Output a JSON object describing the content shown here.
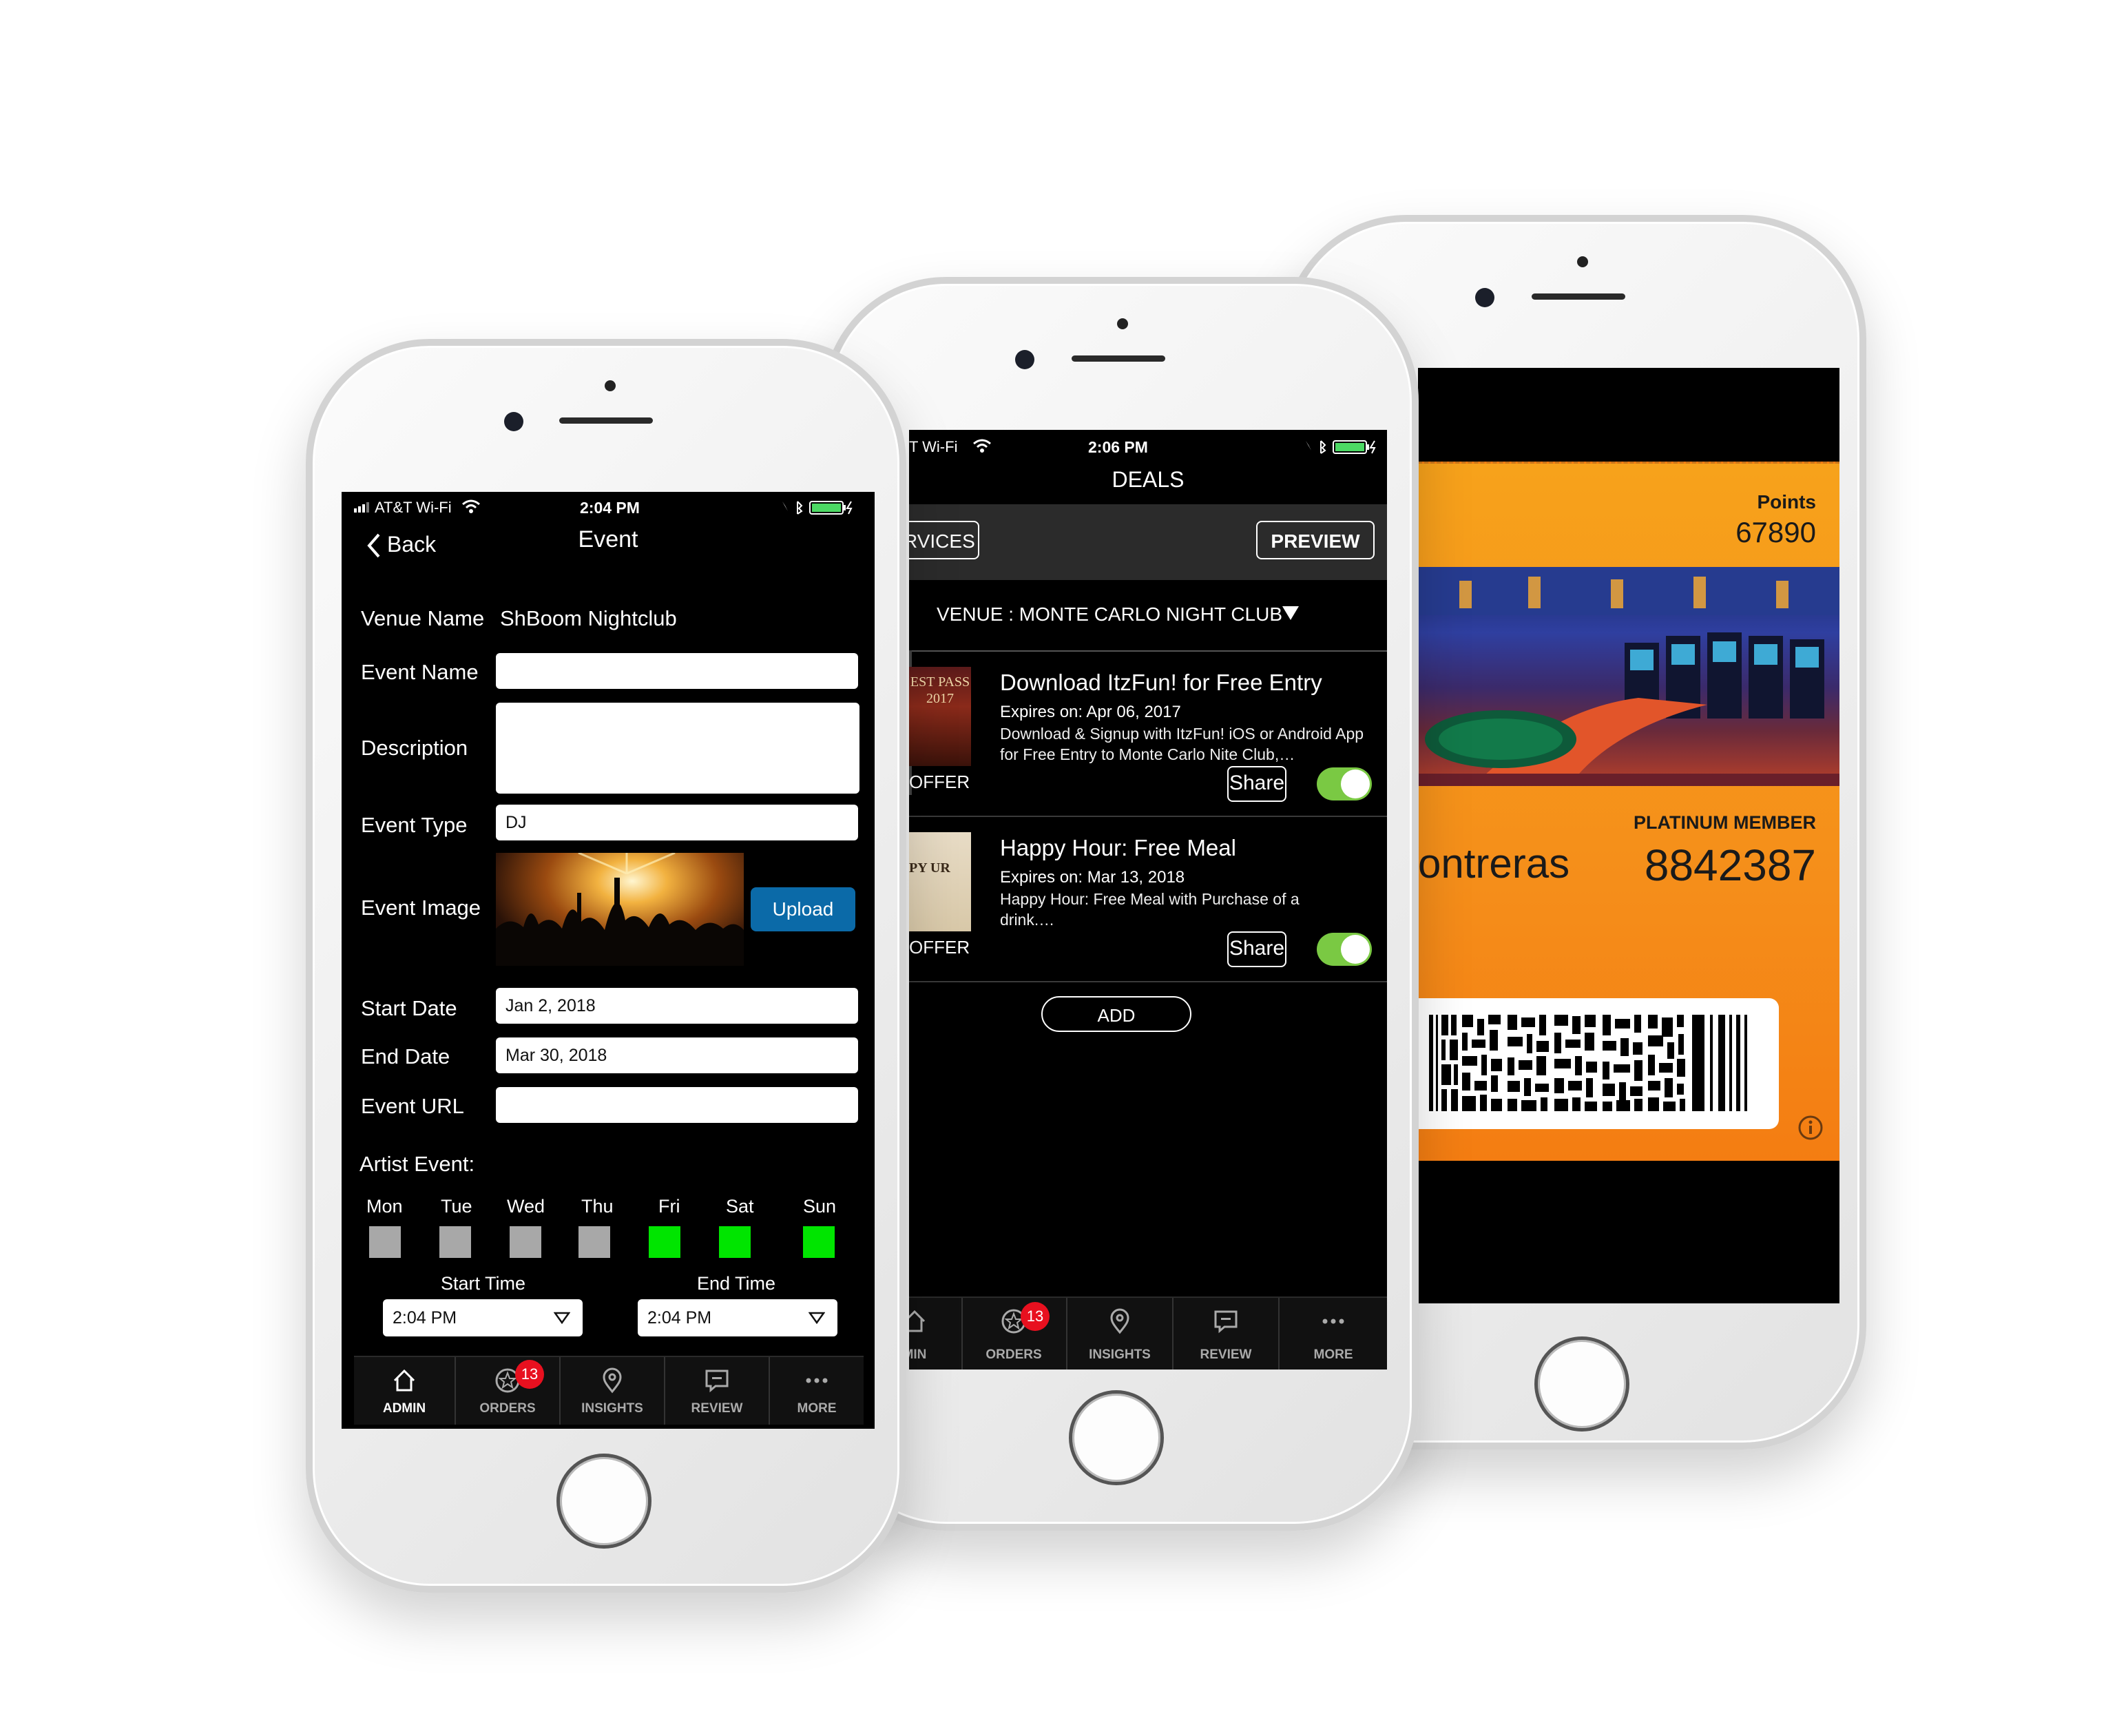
{
  "phone_event": {
    "status": {
      "carrier": "AT&T Wi-Fi",
      "time": "2:04 PM"
    },
    "back_label": "Back",
    "title": "Event",
    "venue_label": "Venue Name",
    "venue_value": "ShBoom Nightclub",
    "event_name_label": "Event Name",
    "event_name_value": "",
    "description_label": "Description",
    "description_value": "",
    "event_type_label": "Event Type",
    "event_type_value": "DJ",
    "event_image_label": "Event Image",
    "upload_label": "Upload",
    "start_date_label": "Start Date",
    "start_date_value": "Jan 2, 2018",
    "end_date_label": "End Date",
    "end_date_value": "Mar 30, 2018",
    "event_url_label": "Event URL",
    "event_url_value": "",
    "artist_event_label": "Artist Event:",
    "days": [
      {
        "label": "Mon",
        "active": false
      },
      {
        "label": "Tue",
        "active": false
      },
      {
        "label": "Wed",
        "active": false
      },
      {
        "label": "Thu",
        "active": false
      },
      {
        "label": "Fri",
        "active": true
      },
      {
        "label": "Sat",
        "active": true
      },
      {
        "label": "Sun",
        "active": true
      }
    ],
    "start_time_label": "Start Time",
    "start_time_value": "2:04 PM",
    "end_time_label": "End Time",
    "end_time_value": "2:04 PM",
    "tabs": [
      {
        "label": "ADMIN",
        "icon": "home-icon",
        "active": true
      },
      {
        "label": "ORDERS",
        "icon": "star-badge-icon",
        "badge": "13"
      },
      {
        "label": "INSIGHTS",
        "icon": "location-pin-icon"
      },
      {
        "label": "REVIEW",
        "icon": "comment-icon"
      },
      {
        "label": "MORE",
        "icon": "more-dots-icon"
      }
    ],
    "colors": {
      "active_day": "#00e500",
      "inactive_day": "#a8a8a8",
      "upload_button": "#0b6aa8"
    }
  },
  "phone_deals": {
    "status": {
      "carrier": "T Wi-Fi",
      "time": "2:06 PM"
    },
    "title": "DEALS",
    "services_label": "RVICES",
    "preview_label": "PREVIEW",
    "venue_selector": "VENUE : MONTE CARLO NIGHT CLUB",
    "deals": [
      {
        "title": "Download ItzFun! for Free Entry",
        "expires": "Expires on: Apr 06, 2017",
        "description": "Download & Signup with ItzFun! iOS or Android App for Free Entry to Monte Carlo Nite Club,…",
        "thumb_text": "EST PASS 2017",
        "tag": "OFFER",
        "share_label": "Share",
        "enabled": true
      },
      {
        "title": "Happy Hour: Free Meal",
        "expires": "Expires on: Mar 13, 2018",
        "description": "Happy Hour: Free Meal with Purchase of a drink.…",
        "thumb_text": "PY UR",
        "tag": "OFFER",
        "share_label": "Share",
        "enabled": true
      }
    ],
    "add_label": "ADD",
    "tabs": [
      {
        "label": "MIN",
        "icon": "home-icon"
      },
      {
        "label": "ORDERS",
        "icon": "star-badge-icon",
        "badge": "13"
      },
      {
        "label": "INSIGHTS",
        "icon": "location-pin-icon"
      },
      {
        "label": "REVIEW",
        "icon": "comment-icon"
      },
      {
        "label": "MORE",
        "icon": "more-dots-icon"
      }
    ],
    "colors": {
      "toggle_on": "#7ac943"
    }
  },
  "phone_pass": {
    "points_label": "Points",
    "points_value": "67890",
    "member_label": "PLATINUM MEMBER",
    "name_fragment": "ontreras",
    "member_number": "8842387",
    "info_icon": "info-icon",
    "colors": {
      "pass_orange": "#f7931e"
    }
  }
}
